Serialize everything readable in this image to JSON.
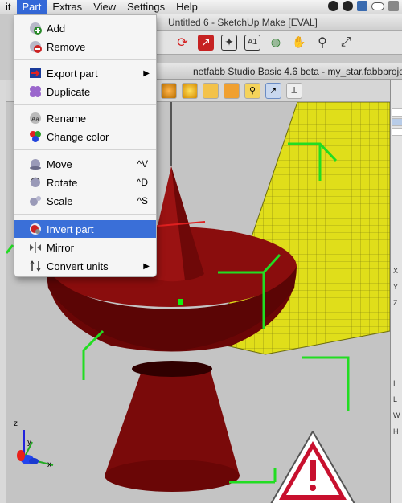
{
  "menubar": {
    "items": [
      "it",
      "Part",
      "Extras",
      "View",
      "Settings",
      "Help"
    ],
    "active": "Part"
  },
  "sketchup": {
    "title": "Untitled 6 - SketchUp Make [EVAL]"
  },
  "netfabb": {
    "title": "netfabb Studio Basic 4.6 beta - my_star.fabbproje"
  },
  "part_menu": {
    "items": [
      {
        "label": "Add"
      },
      {
        "label": "Remove"
      },
      {
        "label": "Export part"
      },
      {
        "label": "Duplicate"
      },
      {
        "label": "Rename"
      },
      {
        "label": "Change color"
      },
      {
        "label": "Move",
        "shortcut": "^V"
      },
      {
        "label": "Rotate",
        "shortcut": "^D"
      },
      {
        "label": "Scale",
        "shortcut": "^S"
      },
      {
        "label": "Invert part"
      },
      {
        "label": "Mirror"
      },
      {
        "label": "Convert units"
      }
    ],
    "highlighted": "Invert part"
  },
  "right_panel": {
    "letters": [
      "X",
      "Y",
      "Z",
      "I",
      "L",
      "W",
      "H"
    ]
  },
  "axes": {
    "z": "z",
    "y": "y",
    "x": "x"
  },
  "colors": {
    "part": "#7a0a0a",
    "platform": "#e4e21a",
    "bbox": "#22dd22",
    "highlight": "#3a6fd8",
    "warning": "#c8102e"
  }
}
